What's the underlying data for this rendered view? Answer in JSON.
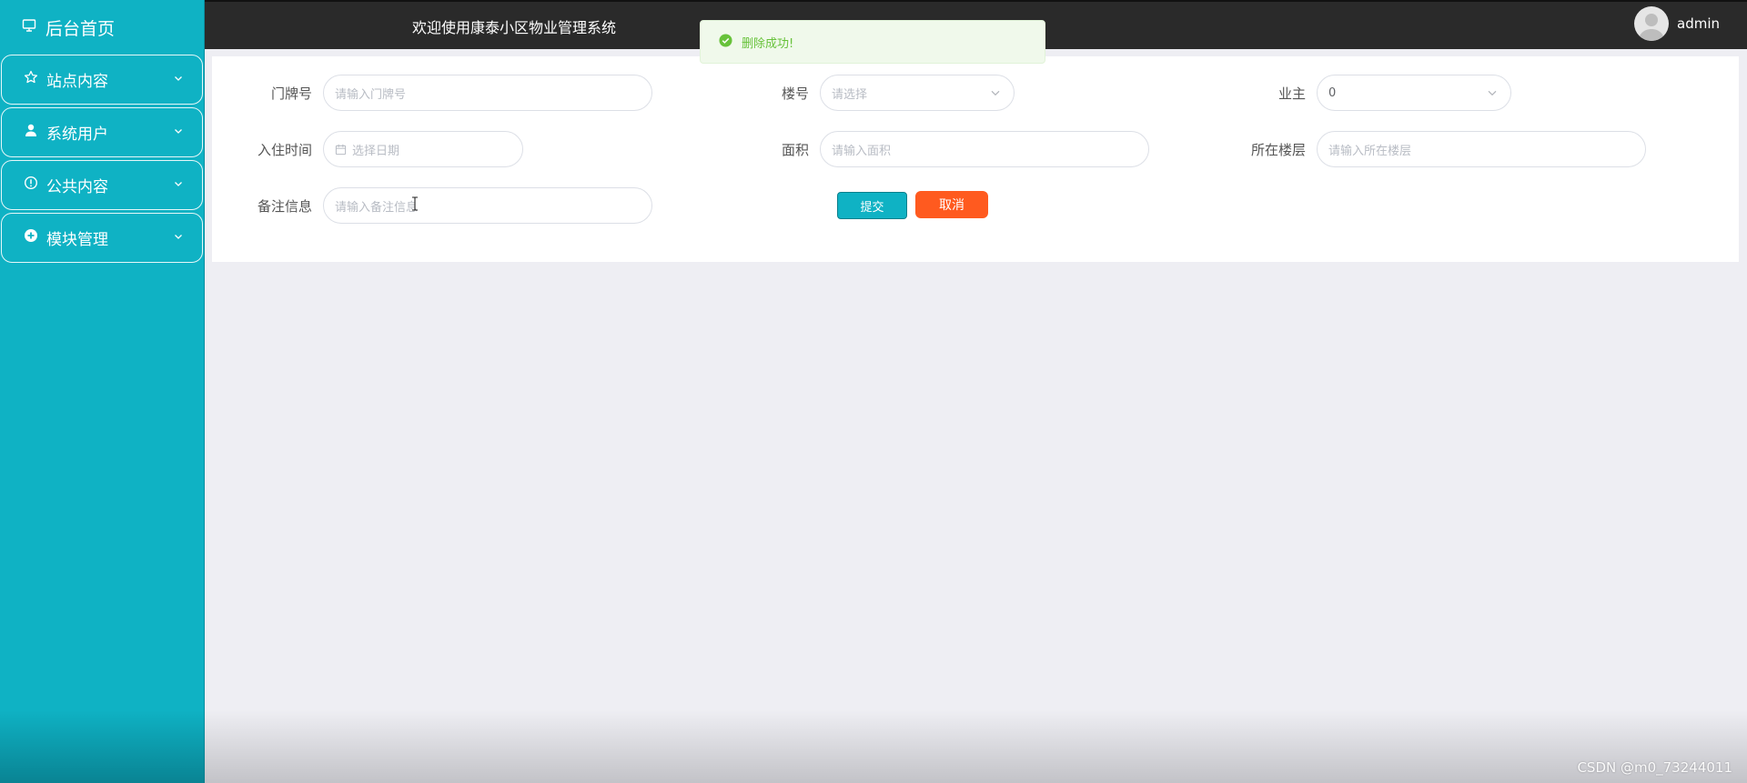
{
  "sidebar": {
    "brand": {
      "label": "后台首页",
      "icon": "monitor-icon"
    },
    "items": [
      {
        "label": "站点内容",
        "icon": "star-icon"
      },
      {
        "label": "系统用户",
        "icon": "user-icon"
      },
      {
        "label": "公共内容",
        "icon": "info-icon"
      },
      {
        "label": "模块管理",
        "icon": "plus-circle-icon"
      }
    ]
  },
  "header": {
    "title": "欢迎使用康泰小区物业管理系统",
    "username": "admin"
  },
  "toast": {
    "message": "删除成功!",
    "type": "success",
    "color": "#67c23a"
  },
  "form": {
    "door_number": {
      "label": "门牌号",
      "placeholder": "请输入门牌号"
    },
    "building": {
      "label": "楼号",
      "placeholder": "请选择"
    },
    "owner": {
      "label": "业主",
      "value": "0"
    },
    "checkin_time": {
      "label": "入住时间",
      "placeholder": "选择日期"
    },
    "area": {
      "label": "面积",
      "placeholder": "请输入面积"
    },
    "floor": {
      "label": "所在楼层",
      "placeholder": "请输入所在楼层"
    },
    "remark": {
      "label": "备注信息",
      "placeholder": "请输入备注信息"
    },
    "submit_label": "提交",
    "cancel_label": "取消"
  },
  "watermark": "CSDN @m0_73244011",
  "colors": {
    "sidebar": "#0fb2c4",
    "header": "#2a2a2a",
    "cancel": "#ff5a1f",
    "background": "#eeeef3"
  }
}
